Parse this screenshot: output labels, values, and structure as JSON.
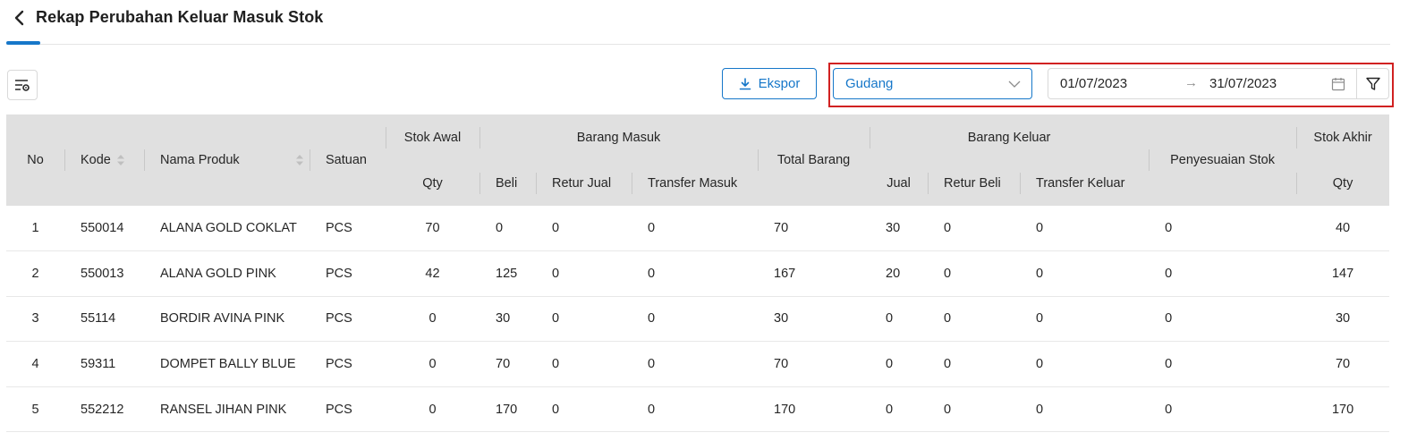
{
  "header": {
    "title": "Rekap Perubahan Keluar Masuk Stok"
  },
  "toolbar": {
    "export_label": "Ekspor",
    "warehouse_select": {
      "selected": "Gudang"
    },
    "date_range": {
      "start": "01/07/2023",
      "arrow": "→",
      "end": "31/07/2023"
    }
  },
  "table": {
    "headers": {
      "no": "No",
      "kode": "Kode",
      "nama_produk": "Nama Produk",
      "satuan": "Satuan",
      "stok_awal": "Stok Awal",
      "stok_awal_qty": "Qty",
      "barang_masuk": "Barang Masuk",
      "beli": "Beli",
      "retur_jual": "Retur Jual",
      "transfer_masuk": "Transfer Masuk",
      "total_barang": "Total Barang",
      "barang_keluar": "Barang Keluar",
      "jual": "Jual",
      "retur_beli": "Retur Beli",
      "transfer_keluar": "Transfer Keluar",
      "penyesuaian_stok": "Penyesuaian Stok",
      "stok_akhir": "Stok Akhir",
      "stok_akhir_qty": "Qty"
    },
    "rows": [
      [
        "1",
        "550014",
        "ALANA GOLD COKLAT",
        "PCS",
        "70",
        "0",
        "0",
        "0",
        "70",
        "30",
        "0",
        "0",
        "0",
        "40"
      ],
      [
        "2",
        "550013",
        "ALANA GOLD PINK",
        "PCS",
        "42",
        "125",
        "0",
        "0",
        "167",
        "20",
        "0",
        "0",
        "0",
        "147"
      ],
      [
        "3",
        "55114",
        "BORDIR AVINA PINK",
        "PCS",
        "0",
        "30",
        "0",
        "0",
        "30",
        "0",
        "0",
        "0",
        "0",
        "30"
      ],
      [
        "4",
        "59311",
        "DOMPET BALLY BLUE",
        "PCS",
        "0",
        "70",
        "0",
        "0",
        "70",
        "0",
        "0",
        "0",
        "0",
        "70"
      ],
      [
        "5",
        "552212",
        "RANSEL JIHAN PINK",
        "PCS",
        "0",
        "170",
        "0",
        "0",
        "170",
        "0",
        "0",
        "0",
        "0",
        "170"
      ]
    ]
  },
  "icons": {
    "back": "chevron-left-icon",
    "settings": "column-settings-icon",
    "export": "download-icon",
    "select": "chevron-down-icon",
    "calendar": "calendar-icon",
    "filter": "filter-icon",
    "sort": "sort-icon"
  },
  "colors": {
    "accent": "#1677c9",
    "highlight": "#d12121",
    "header_bg": "#e0e0e0"
  }
}
